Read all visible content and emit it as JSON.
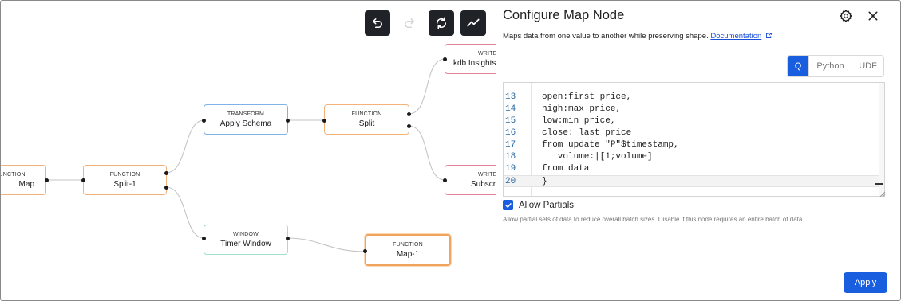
{
  "toolbar": {
    "undo": {
      "icon": "undo-icon"
    },
    "redo": {
      "icon": "redo-icon"
    },
    "refresh": {
      "icon": "refresh-icon"
    },
    "metrics": {
      "icon": "line-chart-icon"
    }
  },
  "nodes": {
    "map_left": {
      "type": "FUNCTION",
      "label": "Map"
    },
    "split1": {
      "type": "FUNCTION",
      "label": "Split-1"
    },
    "apply_schema": {
      "type": "TRANSFORM",
      "label": "Apply Schema"
    },
    "split": {
      "type": "FUNCTION",
      "label": "Split"
    },
    "writer_kdb": {
      "type": "WRITER",
      "label": "kdb Insights D"
    },
    "writer_sub": {
      "type": "WRITER",
      "label": "Subscri"
    },
    "timer_window": {
      "type": "WINDOW",
      "label": "Timer Window"
    },
    "map1": {
      "type": "FUNCTION",
      "label": "Map-1"
    }
  },
  "panel": {
    "title": "Configure Map Node",
    "description": "Maps data from one value to another while preserving shape.",
    "doc_link": "Documentation",
    "languages": [
      {
        "label": "Q",
        "active": true
      },
      {
        "label": "Python",
        "active": false
      },
      {
        "label": "UDF",
        "active": false
      }
    ],
    "code_lines": [
      {
        "num": "13",
        "text": "open:first price,"
      },
      {
        "num": "14",
        "text": "high:max price,"
      },
      {
        "num": "15",
        "text": "low:min price,"
      },
      {
        "num": "16",
        "text": "close: last price"
      },
      {
        "num": "17",
        "text": "from update \"P\"$timestamp,"
      },
      {
        "num": "18",
        "text": "   volume:|[1;volume]"
      },
      {
        "num": "19",
        "text": "from data"
      },
      {
        "num": "20",
        "text": "}"
      }
    ],
    "allow_partials": {
      "label": "Allow Partials",
      "checked": true,
      "help": "Allow partial sets of data to reduce overall batch sizes. Disable if this node requires an entire batch of data."
    },
    "apply_label": "Apply"
  },
  "colors": {
    "function_border": "#f2b27a",
    "transform_border": "#7fb2e5",
    "window_border": "#9fe0c8",
    "writer_border": "#e0839a",
    "accent": "#1a5ee0",
    "toolbar_bg": "#1f2328"
  }
}
